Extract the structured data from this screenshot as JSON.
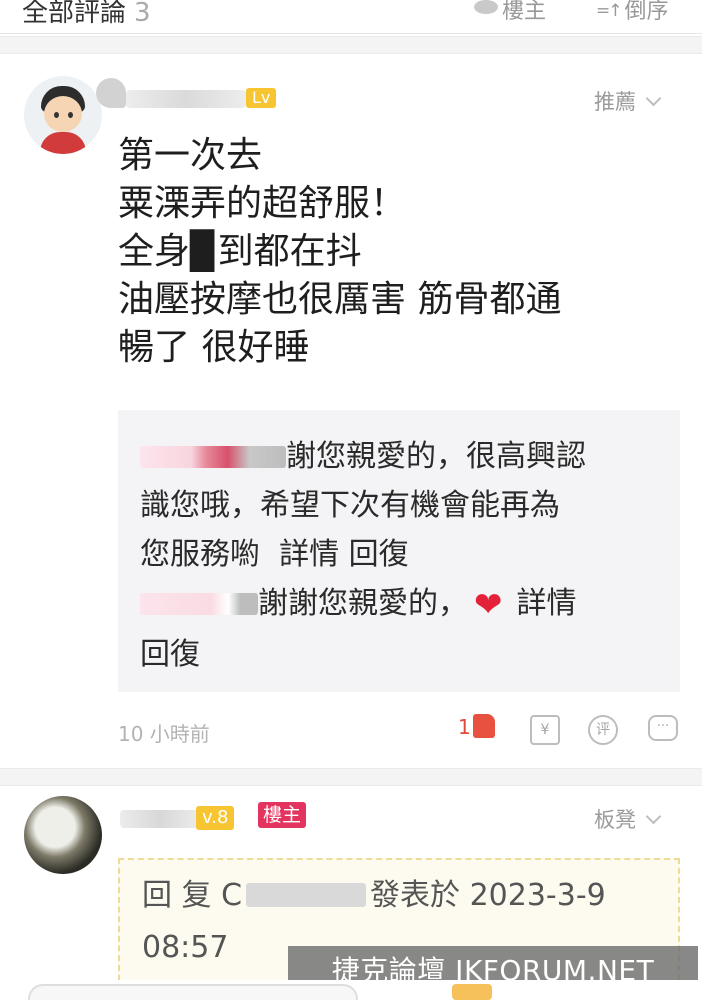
{
  "header": {
    "title": "全部評論",
    "count": "3",
    "louzhu_filter": "樓主",
    "order": "倒序"
  },
  "comment1": {
    "rank": "推薦",
    "level_badge": "Lv",
    "lines": [
      "第一次去",
      "粟溧弄的超舒服！",
      "全身▉到都在抖",
      "油壓按摩也很厲害 筋骨都通",
      "暢了 很好睡"
    ],
    "reply1_text": "謝您親愛的，很高興認",
    "reply1_line2": "識您哦，希望下次有機會能再為",
    "reply1_line3": "您服務喲",
    "reply1_detail": "詳情",
    "reply1_reply": "回復",
    "reply2_text": "謝謝您親愛的，",
    "reply2_heart": "❤",
    "reply2_detail": "詳情",
    "reply2_reply": "回復",
    "time": "10 小時前",
    "likes": "1",
    "icon_gift": "¥",
    "icon_rate": "评",
    "icon_msg": "···"
  },
  "comment2": {
    "rank": "板凳",
    "level_badge": "v.8",
    "louzhu_badge": "樓主",
    "quote_prefix": "回",
    "quote_mid": "复",
    "quote_char": "C",
    "quote_suffix": "發表於 2023-3-9",
    "quote_time": "08:57"
  },
  "watermark": "捷克論壇 JKFORUM.NET",
  "colors": {
    "accent_red": "#e3345f",
    "level_yellow": "#f7c531",
    "like_red": "#e8503f"
  }
}
